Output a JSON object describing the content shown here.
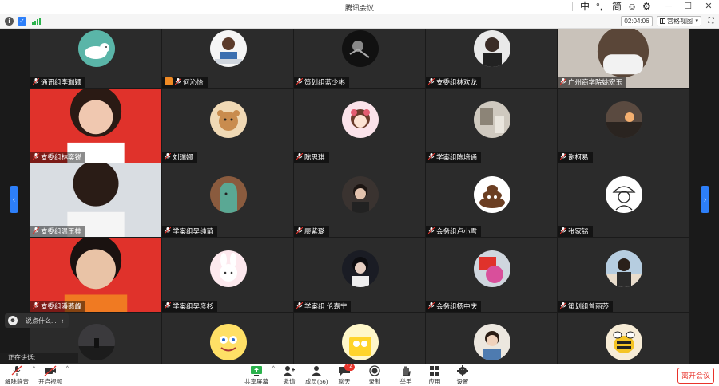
{
  "titlebar": {
    "title": "腾讯会议",
    "ime": [
      "中",
      "°,",
      "简",
      "☺",
      "⚙"
    ],
    "minimize": "─",
    "maximize": "☐",
    "close": "✕"
  },
  "infobar": {
    "timer": "02:04:06",
    "view_label": "宫格视图",
    "view_caret": "▾",
    "fullscreen": "⛶",
    "info_icon": "i",
    "shield_icon": "✓"
  },
  "colors": {
    "accent": "#2d7ff9",
    "danger": "#e8322a",
    "flag_red": "#e0322b",
    "signal_green": "#2bb24c"
  },
  "participants": [
    {
      "name": "通讯组李珈颖",
      "avatar": "sheep"
    },
    {
      "name": "何沁怡",
      "avatar": "photo-girl",
      "highlight": true
    },
    {
      "name": "策划组蓝少彬",
      "avatar": "dark-figure"
    },
    {
      "name": "支委组林欢龙",
      "avatar": "man-dark"
    },
    {
      "name": "广州商学院姚宏玉",
      "avatar": "masked-video",
      "video": true
    },
    {
      "name": "支委组林奕锐",
      "avatar": "party-flag-woman",
      "video": true,
      "red": true
    },
    {
      "name": "刘瑞娜",
      "avatar": "bear"
    },
    {
      "name": "陈思琪",
      "avatar": "anime-girl"
    },
    {
      "name": "学案组陈培通",
      "avatar": "room"
    },
    {
      "name": "谢柯易",
      "avatar": "sunset"
    },
    {
      "name": "支委组温玉桂",
      "avatar": "man-room",
      "video": true,
      "photo": true
    },
    {
      "name": "学案组吴纯苗",
      "avatar": "green-dino"
    },
    {
      "name": "廖紫璐",
      "avatar": "boy-portrait"
    },
    {
      "name": "会务组卢小雪",
      "avatar": "poop-emoji"
    },
    {
      "name": "张家铭",
      "avatar": "sketch-hat"
    },
    {
      "name": "支委组潘燕峰",
      "avatar": "party-flag-man",
      "video": true,
      "red": true
    },
    {
      "name": "学案组吴彦杉",
      "avatar": "bunny"
    },
    {
      "name": "学案组 伦嘉宁",
      "avatar": "boy-dark"
    },
    {
      "name": "会务组杨中庆",
      "avatar": "flag-sticker"
    },
    {
      "name": "策划组曾丽莎",
      "avatar": "woman-beach"
    },
    {
      "name": "",
      "avatar": "dark-landscape"
    },
    {
      "name": "",
      "avatar": "spongebob"
    },
    {
      "name": "",
      "avatar": "lucky-sponge"
    },
    {
      "name": "",
      "avatar": "child"
    },
    {
      "name": "",
      "avatar": "bee"
    }
  ],
  "chat": {
    "placeholder": "说点什么...",
    "collapse": "‹"
  },
  "speaking_label": "正在讲话:",
  "side_arrows": {
    "left": "‹",
    "right": "›"
  },
  "toolbar": {
    "unmute": "解除静音",
    "start_video": "开启视频",
    "share_screen": "共享屏幕",
    "invite": "邀请",
    "members": "成员(56)",
    "chat": "聊天",
    "chat_badge": "14",
    "record": "录制",
    "raise_hand": "举手",
    "apps": "应用",
    "settings": "设置",
    "leave": "离开会议"
  }
}
